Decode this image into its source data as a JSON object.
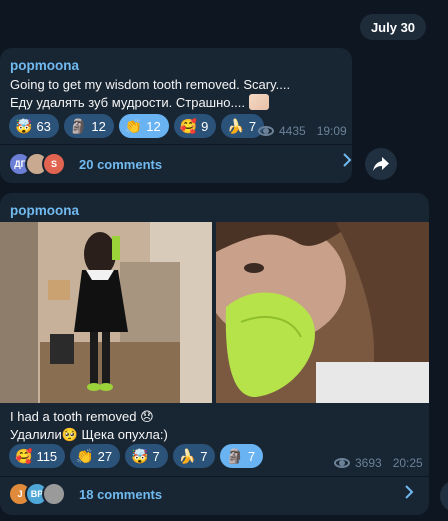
{
  "date_label": "July 30",
  "messages": [
    {
      "author": "popmoona",
      "lines": [
        "Going to get my wisdom tooth removed. Scary....",
        "Еду удалять зуб мудрости. Страшно...."
      ],
      "reactions": [
        {
          "emoji": "🤯",
          "count": "63"
        },
        {
          "emoji": "🗿",
          "count": "12"
        },
        {
          "emoji": "👏",
          "count": "12",
          "selected": true
        },
        {
          "emoji": "🥰",
          "count": "9"
        },
        {
          "emoji": "🍌",
          "count": "7"
        }
      ],
      "views": "4435",
      "time": "19:09",
      "comment_avatars": [
        "ДГ",
        "",
        "S"
      ],
      "comments_label": "20 comments"
    },
    {
      "author": "popmoona",
      "lines": [
        "I had a tooth removed 😞",
        "Удалили🥺 Щека опухла:)"
      ],
      "reactions": [
        {
          "emoji": "🥰",
          "count": "115"
        },
        {
          "emoji": "👏",
          "count": "27"
        },
        {
          "emoji": "🤯",
          "count": "7"
        },
        {
          "emoji": "🍌",
          "count": "7"
        },
        {
          "emoji": "🗿",
          "count": "7",
          "selected": true
        }
      ],
      "views": "3693",
      "time": "20:25",
      "comment_avatars": [
        "J",
        "BP",
        ""
      ],
      "comments_label": "18 comments"
    }
  ],
  "icons": {
    "views": "eye-icon",
    "share": "share-arrow-icon",
    "chevron": "chevron-right-icon"
  },
  "colors": {
    "background": "#0e1621",
    "bubble": "#182533",
    "accent": "#71baf0",
    "reaction": "#2b5278",
    "reaction_selected": "#6ab3f3"
  }
}
